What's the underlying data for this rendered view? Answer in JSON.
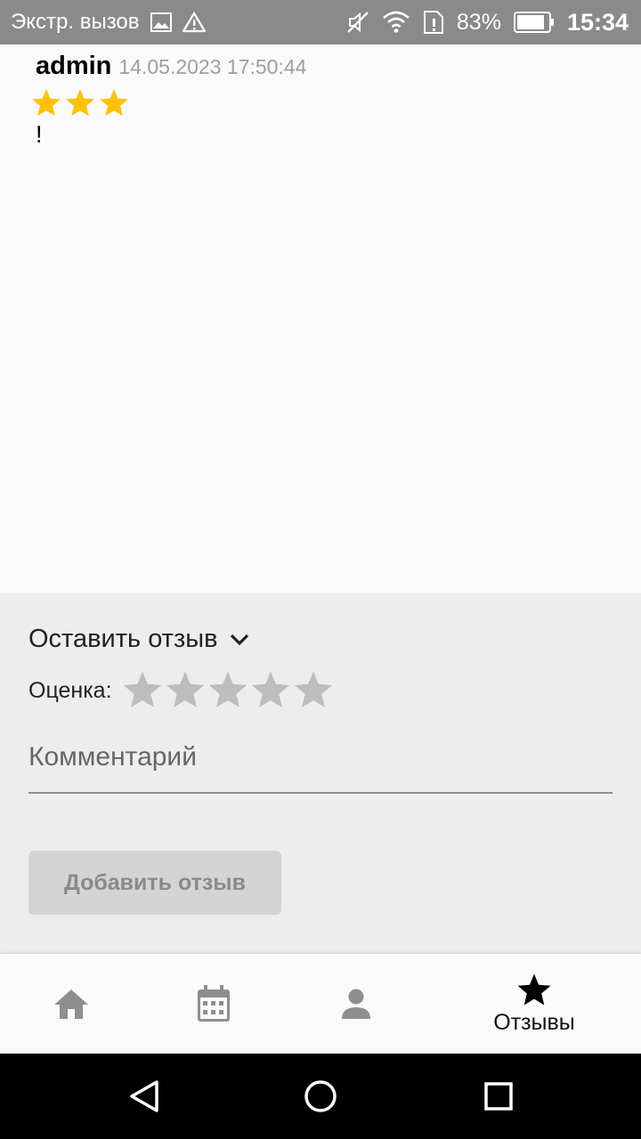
{
  "status_bar": {
    "carrier": "Экстр. вызов",
    "battery": "83%",
    "time": "15:34",
    "icons": [
      "image-icon",
      "warning-icon",
      "mute-icon",
      "wifi-icon",
      "sim-alert-icon",
      "battery-icon"
    ]
  },
  "review": {
    "author": "admin",
    "date": "14.05.2023 17:50:44",
    "rating": 3,
    "text": "!"
  },
  "form": {
    "title": "Оставить отзыв",
    "rating_label": "Оценка:",
    "rating_max": 5,
    "comment_placeholder": "Комментарий",
    "comment_value": "",
    "submit_label": "Добавить отзыв"
  },
  "bottom_nav": {
    "items": [
      {
        "icon": "home-icon",
        "label": ""
      },
      {
        "icon": "calendar-icon",
        "label": ""
      },
      {
        "icon": "person-icon",
        "label": ""
      },
      {
        "icon": "star-icon",
        "label": "Отзывы",
        "active": true
      }
    ]
  },
  "colors": {
    "star_filled": "#FFC107",
    "star_empty": "#BDBDBD",
    "status_bar": "#8A8A8A",
    "form_bg": "#EDEDED"
  }
}
